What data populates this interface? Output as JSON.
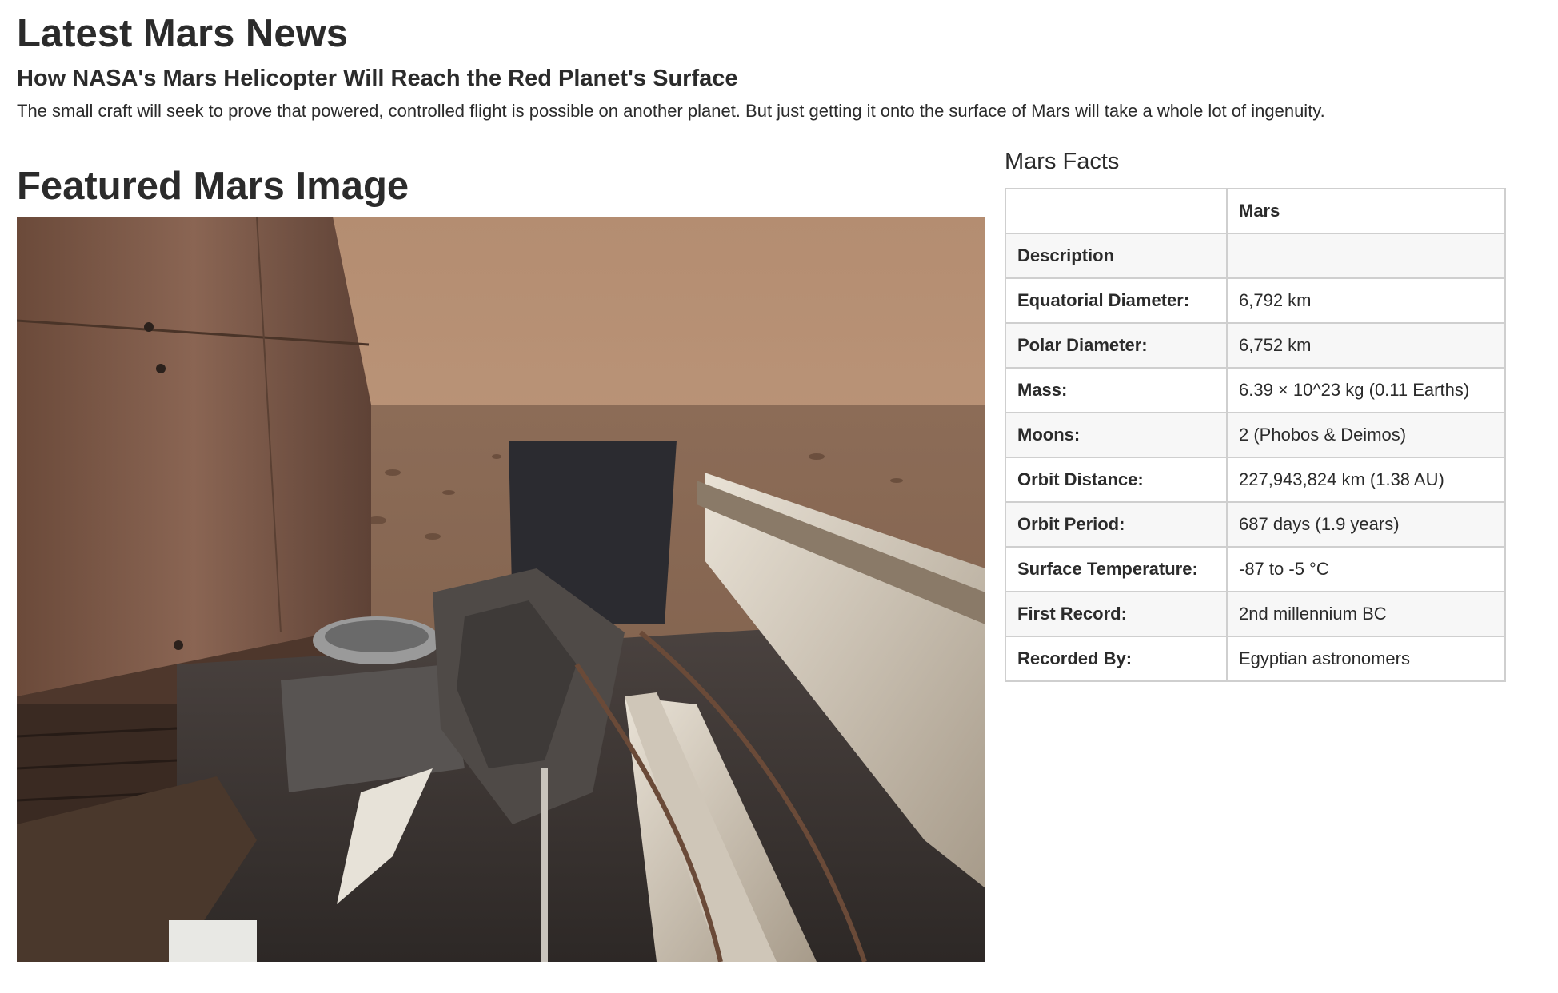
{
  "news": {
    "section_title": "Latest Mars News",
    "headline": "How NASA's Mars Helicopter Will Reach the Red Planet's Surface",
    "teaser": "The small craft will seek to prove that powered, controlled flight is possible on another planet. But just getting it onto the surface of Mars will take a whole lot of ingenuity."
  },
  "featured": {
    "section_title": "Featured Mars Image"
  },
  "facts": {
    "section_title": "Mars Facts",
    "column_header": "Mars",
    "rows": [
      {
        "label": "Description",
        "value": ""
      },
      {
        "label": "Equatorial Diameter:",
        "value": "6,792 km"
      },
      {
        "label": "Polar Diameter:",
        "value": "6,752 km"
      },
      {
        "label": "Mass:",
        "value": "6.39 × 10^23 kg (0.11 Earths)"
      },
      {
        "label": "Moons:",
        "value": "2 (Phobos & Deimos)"
      },
      {
        "label": "Orbit Distance:",
        "value": "227,943,824 km (1.38 AU)"
      },
      {
        "label": "Orbit Period:",
        "value": "687 days (1.9 years)"
      },
      {
        "label": "Surface Temperature:",
        "value": "-87 to -5 °C"
      },
      {
        "label": "First Record:",
        "value": "2nd millennium BC"
      },
      {
        "label": "Recorded By:",
        "value": "Egyptian astronomers"
      }
    ]
  },
  "colors": {
    "text": "#2b2b2b",
    "table_border": "#111111",
    "table_grid": "#cfcfcf",
    "row_stripe": "#f7f7f7"
  }
}
